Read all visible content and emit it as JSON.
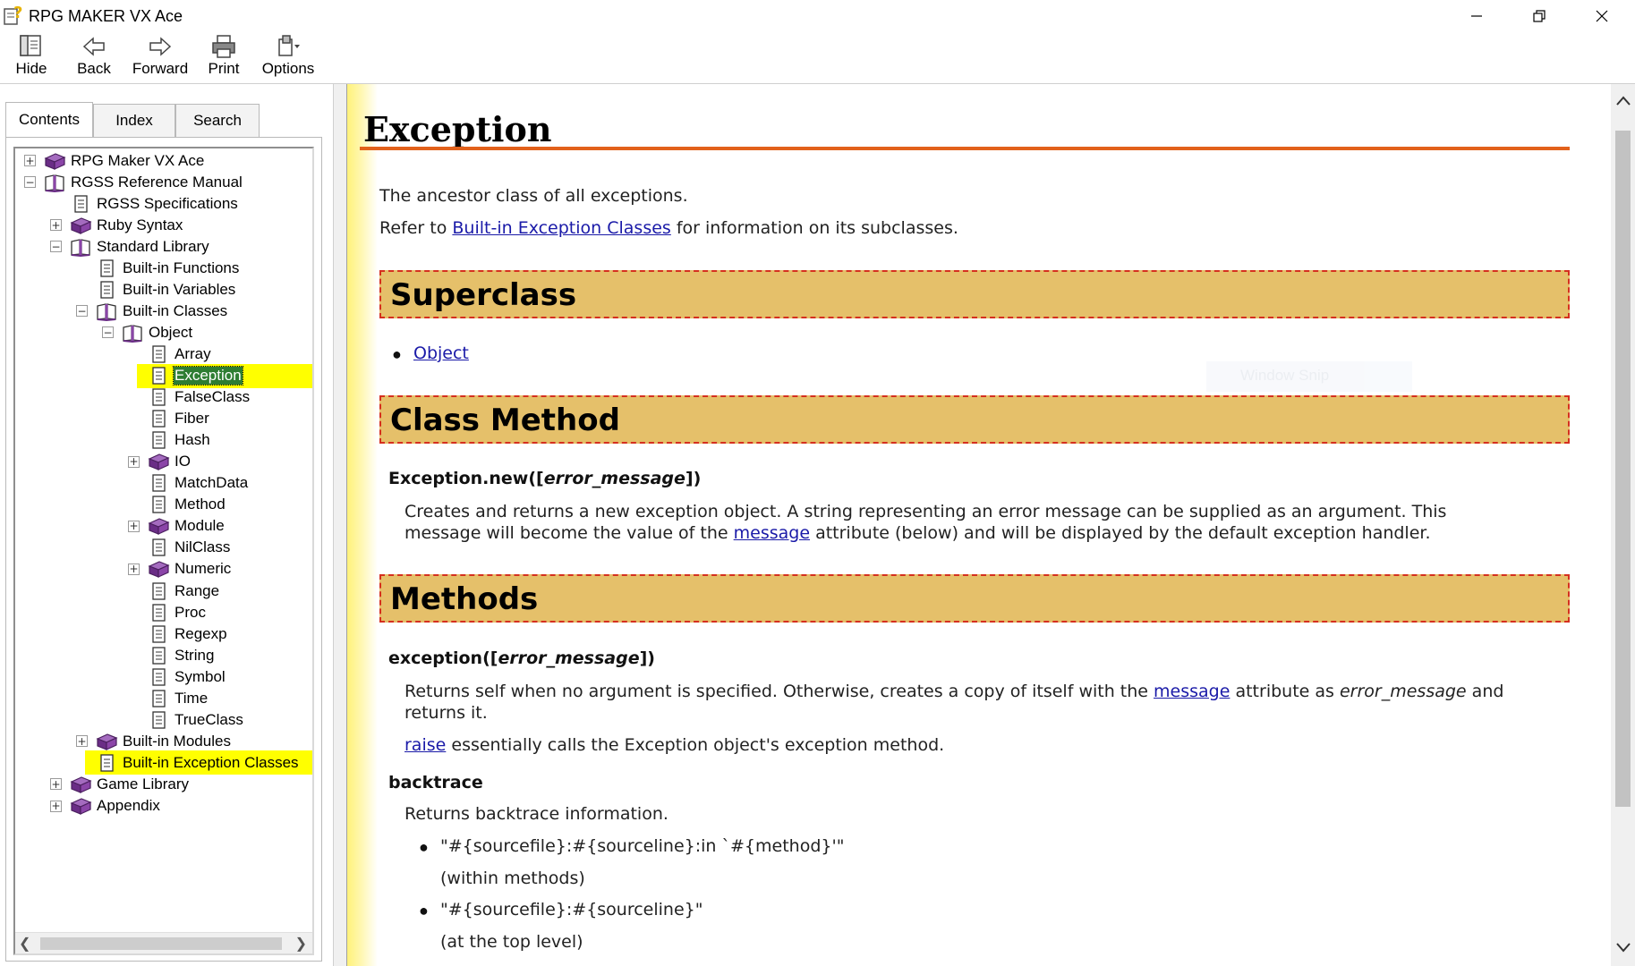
{
  "window": {
    "title": "RPG MAKER VX Ace"
  },
  "toolbar": {
    "buttons": [
      {
        "label": "Hide",
        "icon": "hide-icon"
      },
      {
        "label": "Back",
        "icon": "back-arrow-icon"
      },
      {
        "label": "Forward",
        "icon": "forward-arrow-icon"
      },
      {
        "label": "Print",
        "icon": "printer-icon"
      },
      {
        "label": "Options",
        "icon": "options-icon"
      }
    ]
  },
  "nav": {
    "tabs": [
      "Contents",
      "Index",
      "Search"
    ],
    "active_tab": "Contents",
    "tree": [
      {
        "label": "RPG Maker VX Ace",
        "icon": "book-closed-icon",
        "expander": "+"
      },
      {
        "label": "RGSS Reference Manual",
        "icon": "book-open-icon",
        "expander": "-"
      },
      {
        "label": "RGSS Specifications",
        "icon": "page-icon",
        "expander": ""
      },
      {
        "label": "Ruby Syntax",
        "icon": "book-closed-icon",
        "expander": "+"
      },
      {
        "label": "Standard Library",
        "icon": "book-open-icon",
        "expander": "-"
      },
      {
        "label": "Built-in Functions",
        "icon": "page-icon",
        "expander": ""
      },
      {
        "label": "Built-in Variables",
        "icon": "page-icon",
        "expander": ""
      },
      {
        "label": "Built-in Classes",
        "icon": "book-open-icon",
        "expander": "-"
      },
      {
        "label": "Object",
        "icon": "book-open-icon",
        "expander": "-"
      },
      {
        "label": "Array",
        "icon": "page-icon",
        "expander": ""
      },
      {
        "label": "Exception",
        "icon": "page-icon",
        "expander": "",
        "selected": true
      },
      {
        "label": "FalseClass",
        "icon": "page-icon",
        "expander": ""
      },
      {
        "label": "Fiber",
        "icon": "page-icon",
        "expander": ""
      },
      {
        "label": "Hash",
        "icon": "page-icon",
        "expander": ""
      },
      {
        "label": "IO",
        "icon": "book-closed-icon",
        "expander": "+"
      },
      {
        "label": "MatchData",
        "icon": "page-icon",
        "expander": ""
      },
      {
        "label": "Method",
        "icon": "page-icon",
        "expander": ""
      },
      {
        "label": "Module",
        "icon": "book-closed-icon",
        "expander": "+"
      },
      {
        "label": "NilClass",
        "icon": "page-icon",
        "expander": ""
      },
      {
        "label": "Numeric",
        "icon": "book-closed-icon",
        "expander": "+"
      },
      {
        "label": "Range",
        "icon": "page-icon",
        "expander": ""
      },
      {
        "label": "Proc",
        "icon": "page-icon",
        "expander": ""
      },
      {
        "label": "Regexp",
        "icon": "page-icon",
        "expander": ""
      },
      {
        "label": "String",
        "icon": "page-icon",
        "expander": ""
      },
      {
        "label": "Symbol",
        "icon": "page-icon",
        "expander": ""
      },
      {
        "label": "Time",
        "icon": "page-icon",
        "expander": ""
      },
      {
        "label": "TrueClass",
        "icon": "page-icon",
        "expander": ""
      },
      {
        "label": "Built-in Modules",
        "icon": "book-closed-icon",
        "expander": "+"
      },
      {
        "label": "Built-in Exception Classes",
        "icon": "page-icon",
        "expander": "",
        "highlighted": true
      },
      {
        "label": "Game Library",
        "icon": "book-closed-icon",
        "expander": "+"
      },
      {
        "label": "Appendix",
        "icon": "book-closed-icon",
        "expander": "+"
      }
    ]
  },
  "content": {
    "title": "Exception",
    "intro": "The ancestor class of all exceptions.",
    "refer_prefix": "Refer to",
    "refer_link": "Built-in Exception Classes",
    "refer_suffix": "for information on its subclasses.",
    "superclass_heading": "Superclass",
    "superclass_link": "Object",
    "class_method_heading": "Class Method",
    "new_method": {
      "prefix": "Exception.new([",
      "arg": "error_message",
      "suffix": "])",
      "desc_line1": "Creates and returns a new exception object. A string representing an error message can be supplied as an argument. This",
      "desc_line2_prefix": "message will become the value of the",
      "desc_line2_link": "message",
      "desc_line2_suffix": "attribute (below) and will be displayed by the default exception handler."
    },
    "methods_heading": "Methods",
    "exception_method": {
      "prefix": "exception([",
      "arg": "error_message",
      "suffix": "])",
      "desc_line1_prefix": "Returns self when no argument is specified. Otherwise, creates a copy of itself with the",
      "desc_line1_link": "message",
      "desc_line1_mid": "attribute as",
      "desc_line1_arg": "error_message",
      "desc_line1_end": "and",
      "desc_line2": "returns it.",
      "raise_link": "raise",
      "raise_suffix": "essentially calls the Exception object's exception method."
    },
    "backtrace": {
      "name": "backtrace",
      "desc": "Returns backtrace information.",
      "items": [
        {
          "format": "\"#{sourcefile}:#{sourceline}:in `#{method}'\"",
          "note": "(within methods)"
        },
        {
          "format": "\"#{sourcefile}:#{sourceline}\"",
          "note": "(at the top level)"
        }
      ]
    },
    "overlay_text": "Window Snip"
  },
  "colors": {
    "section_fill": "#e5c06a",
    "section_border": "#d5301f",
    "title_rule": "#e2611b",
    "link": "#1a1aa8",
    "highlight": "#ffff00",
    "selection": "#2e7d32"
  }
}
